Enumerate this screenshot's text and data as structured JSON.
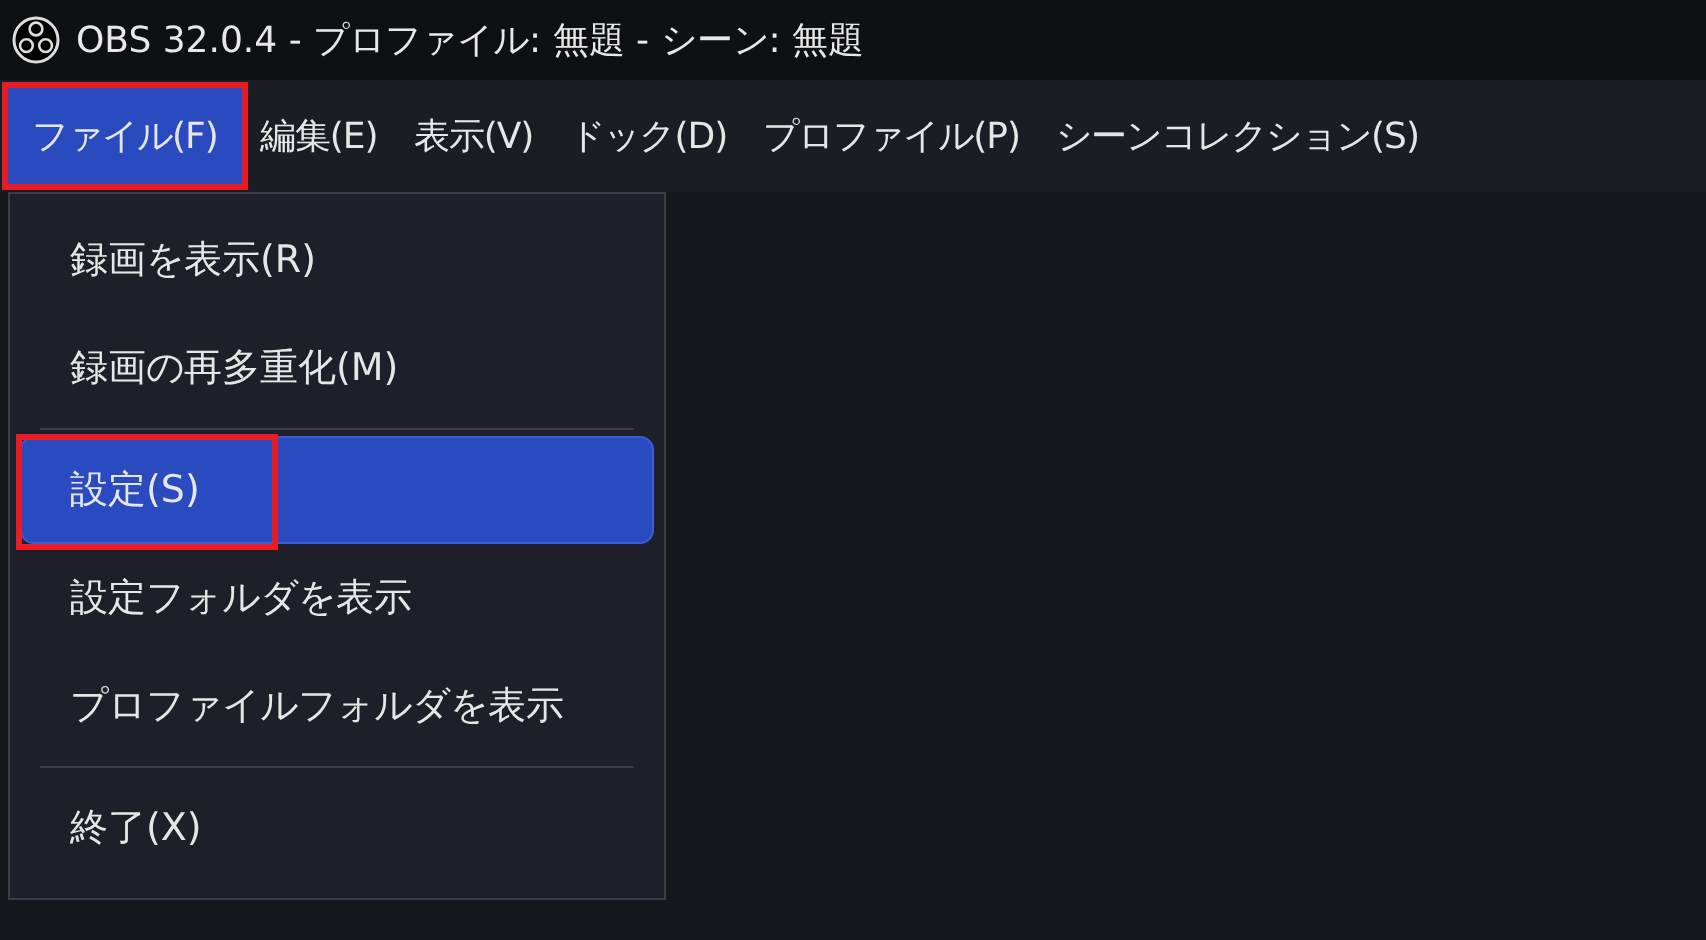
{
  "window": {
    "title": "OBS 32.0.4 - プロファイル: 無題 - シーン: 無題"
  },
  "menubar": [
    {
      "label": "ファイル(F)",
      "selected": true,
      "annotated": true
    },
    {
      "label": "編集(E)",
      "selected": false,
      "annotated": false
    },
    {
      "label": "表示(V)",
      "selected": false,
      "annotated": false
    },
    {
      "label": "ドック(D)",
      "selected": false,
      "annotated": false
    },
    {
      "label": "プロファイル(P)",
      "selected": false,
      "annotated": false
    },
    {
      "label": "シーンコレクション(S)",
      "selected": false,
      "annotated": false
    }
  ],
  "file_menu": [
    {
      "kind": "item",
      "label": "録画を表示(R)",
      "selected": false,
      "annotated": false
    },
    {
      "kind": "item",
      "label": "録画の再多重化(M)",
      "selected": false,
      "annotated": false
    },
    {
      "kind": "separator"
    },
    {
      "kind": "item",
      "label": "設定(S)",
      "selected": true,
      "annotated": true
    },
    {
      "kind": "item",
      "label": "設定フォルダを表示",
      "selected": false,
      "annotated": false
    },
    {
      "kind": "item",
      "label": "プロファイルフォルダを表示",
      "selected": false,
      "annotated": false
    },
    {
      "kind": "separator"
    },
    {
      "kind": "item",
      "label": "終了(X)",
      "selected": false,
      "annotated": false
    }
  ]
}
